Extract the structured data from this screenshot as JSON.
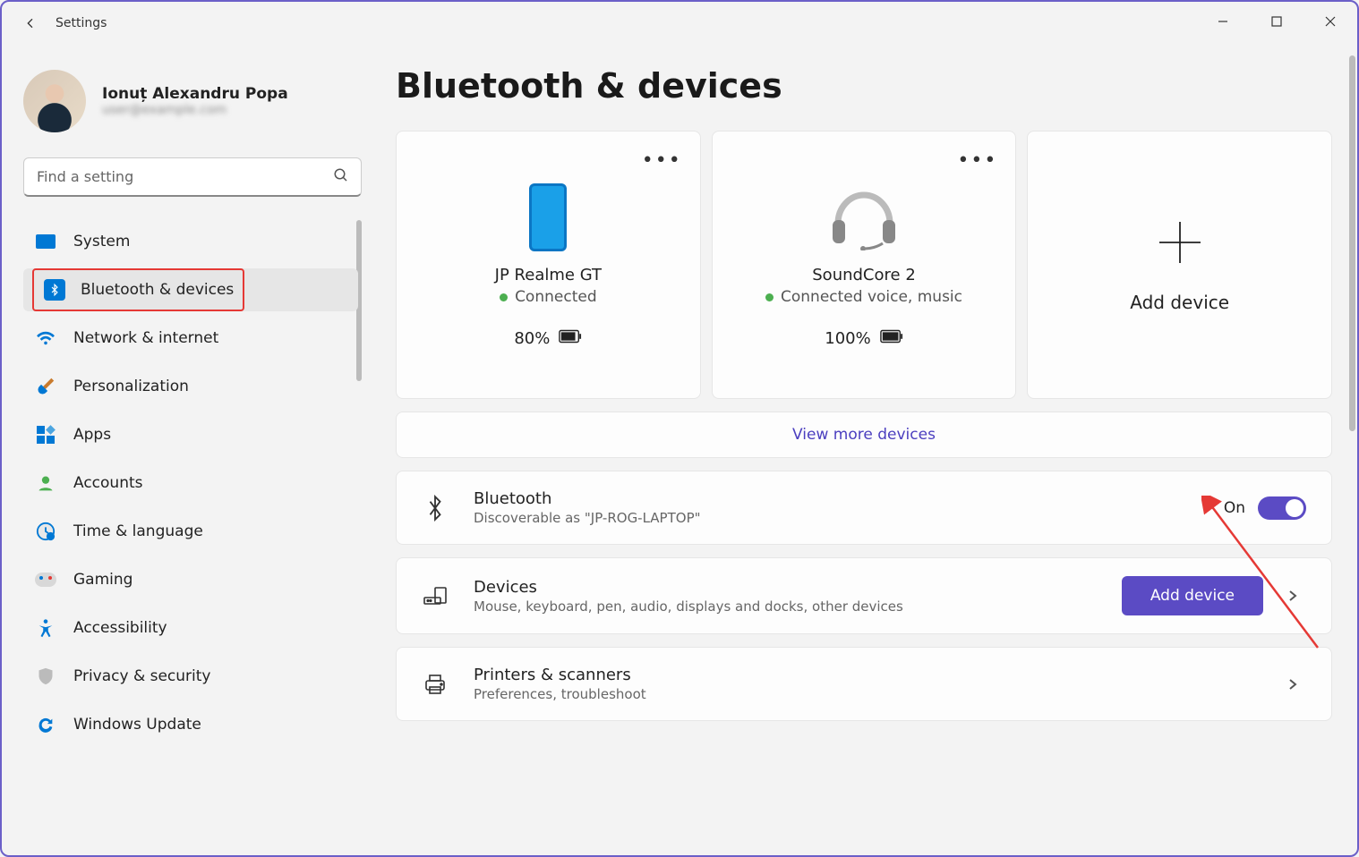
{
  "app": {
    "title": "Settings"
  },
  "profile": {
    "name": "Ionuț Alexandru Popa",
    "email": "user@example.com"
  },
  "search": {
    "placeholder": "Find a setting"
  },
  "nav": {
    "items": [
      {
        "label": "System"
      },
      {
        "label": "Bluetooth & devices"
      },
      {
        "label": "Network & internet"
      },
      {
        "label": "Personalization"
      },
      {
        "label": "Apps"
      },
      {
        "label": "Accounts"
      },
      {
        "label": "Time & language"
      },
      {
        "label": "Gaming"
      },
      {
        "label": "Accessibility"
      },
      {
        "label": "Privacy & security"
      },
      {
        "label": "Windows Update"
      }
    ]
  },
  "page": {
    "title": "Bluetooth & devices",
    "devices": [
      {
        "name": "JP Realme GT",
        "status": "Connected",
        "battery": "80%"
      },
      {
        "name": "SoundCore 2",
        "status": "Connected voice, music",
        "battery": "100%"
      }
    ],
    "add_device_card": "Add device",
    "view_more": "View more devices",
    "bluetooth": {
      "title": "Bluetooth",
      "sub": "Discoverable as \"JP-ROG-LAPTOP\"",
      "state": "On"
    },
    "rows": {
      "devices": {
        "title": "Devices",
        "sub": "Mouse, keyboard, pen, audio, displays and docks, other devices",
        "button": "Add device"
      },
      "printers": {
        "title": "Printers & scanners",
        "sub": "Preferences, troubleshoot"
      }
    }
  }
}
